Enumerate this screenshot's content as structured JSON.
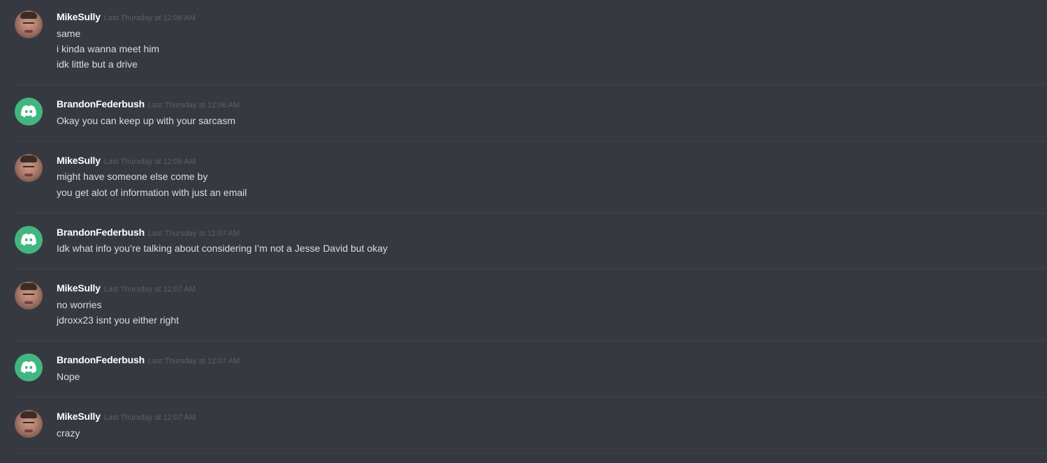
{
  "messages": [
    {
      "username": "MikeSully",
      "timestamp": "Last Thursday at 12:06 AM",
      "avatar": "user-photo-avatar",
      "lines": [
        "same",
        "i kinda wanna meet him",
        "idk little but a drive"
      ]
    },
    {
      "username": "BrandonFederbush",
      "timestamp": "Last Thursday at 12:06 AM",
      "avatar": "discord-logo-avatar",
      "lines": [
        "Okay you can keep up with your sarcasm"
      ]
    },
    {
      "username": "MikeSully",
      "timestamp": "Last Thursday at 12:06 AM",
      "avatar": "user-photo-avatar",
      "lines": [
        "might have someone else come by",
        "you get alot of information with just an email"
      ]
    },
    {
      "username": "BrandonFederbush",
      "timestamp": "Last Thursday at 12:07 AM",
      "avatar": "discord-logo-avatar",
      "lines": [
        "Idk what info you’re talking about considering I’m not a Jesse David but okay"
      ]
    },
    {
      "username": "MikeSully",
      "timestamp": "Last Thursday at 12:07 AM",
      "avatar": "user-photo-avatar",
      "lines": [
        "no worries",
        "jdroxx23 isnt you either right"
      ]
    },
    {
      "username": "BrandonFederbush",
      "timestamp": "Last Thursday at 12:07 AM",
      "avatar": "discord-logo-avatar",
      "lines": [
        "Nope"
      ]
    },
    {
      "username": "MikeSully",
      "timestamp": "Last Thursday at 12:07 AM",
      "avatar": "user-photo-avatar",
      "lines": [
        "crazy"
      ]
    }
  ],
  "colors": {
    "background": "#36393f",
    "username": "#ffffff",
    "timestamp": "#5d6066",
    "message_text": "#dcddde",
    "discord_avatar": "#43b581",
    "divider": "#3f4248"
  }
}
